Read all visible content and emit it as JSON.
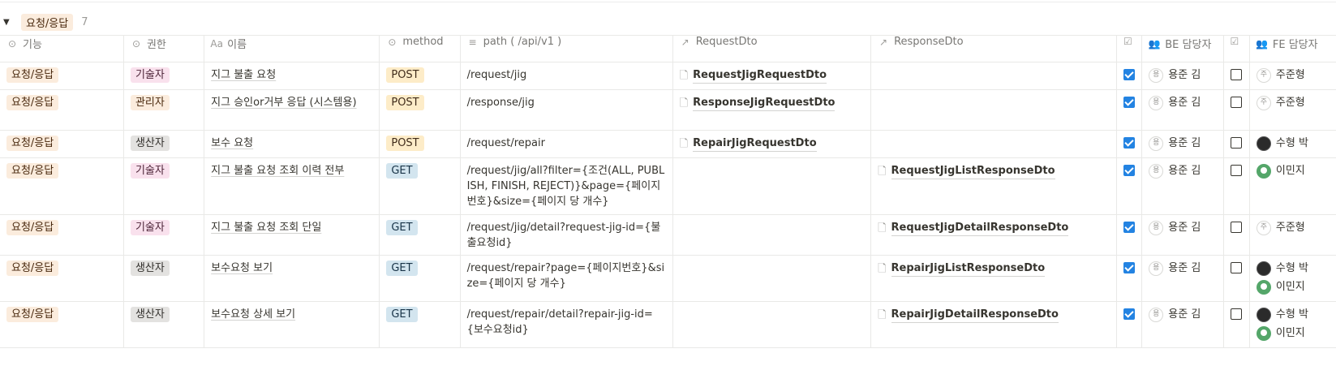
{
  "group": {
    "label": "요청/응답",
    "count": "7"
  },
  "columns": [
    {
      "label": "기능",
      "icon": "select-icon"
    },
    {
      "label": "권한",
      "icon": "select-icon"
    },
    {
      "label": "이름",
      "icon": "title-icon"
    },
    {
      "label": "method",
      "icon": "select-icon"
    },
    {
      "label": "path ( /api/v1 )",
      "icon": "text-icon"
    },
    {
      "label": "RequestDto",
      "icon": "relation-icon"
    },
    {
      "label": "ResponseDto",
      "icon": "relation-icon"
    },
    {
      "label": "",
      "icon": "checkbox-icon"
    },
    {
      "label": "BE 담당자",
      "icon": "person-icon"
    },
    {
      "label": "",
      "icon": "checkbox-icon"
    },
    {
      "label": "FE 담당자",
      "icon": "person-icon"
    }
  ],
  "rows": [
    {
      "feature": "요청/응답",
      "role": "기술자",
      "name": "지그 불출 요청",
      "method": "POST",
      "path": "/request/jig",
      "request_dto": "RequestJigRequestDto",
      "response_dto": "",
      "be_done": true,
      "be": "용준 김",
      "fe_done": false,
      "fe": [
        {
          "name": "주준형",
          "avatar": "주"
        }
      ]
    },
    {
      "feature": "요청/응답",
      "role": "관리자",
      "name": "지그 승인or거부 응답 (시스템용)",
      "method": "POST",
      "path": "/response/jig",
      "request_dto": "ResponseJigRequestDto",
      "response_dto": "",
      "be_done": true,
      "be": "용준 김",
      "fe_done": false,
      "fe": [
        {
          "name": "주준형",
          "avatar": "주"
        }
      ]
    },
    {
      "feature": "요청/응답",
      "role": "생산자",
      "name": "보수 요청",
      "method": "POST",
      "path": "/request/repair",
      "request_dto": "RepairJigRequestDto",
      "response_dto": "",
      "be_done": true,
      "be": "용준 김",
      "fe_done": false,
      "fe": [
        {
          "name": "수형 박",
          "avatar": ""
        }
      ]
    },
    {
      "feature": "요청/응답",
      "role": "기술자",
      "name": "지그 불출 요청 조회 이력 전부",
      "method": "GET",
      "path": "/request/jig/all?filter={조건(ALL, PUBLISH, FINISH, REJECT)}&page={페이지번호}&size={페이지 당 개수}",
      "request_dto": "",
      "response_dto": "RequestJigListResponseDto",
      "be_done": true,
      "be": "용준 김",
      "fe_done": false,
      "fe": [
        {
          "name": "이민지",
          "avatar": ""
        }
      ]
    },
    {
      "feature": "요청/응답",
      "role": "기술자",
      "name": "지그 불출 요청 조회 단일",
      "method": "GET",
      "path": "/request/jig/detail?request-jig-id={불출요청id}",
      "request_dto": "",
      "response_dto": "RequestJigDetailResponseDto",
      "be_done": true,
      "be": "용준 김",
      "fe_done": false,
      "fe": [
        {
          "name": "주준형",
          "avatar": "주"
        }
      ]
    },
    {
      "feature": "요청/응답",
      "role": "생산자",
      "name": "보수요청 보기",
      "method": "GET",
      "path": "/request/repair?page={페이지번호}&size={페이지 당 개수}",
      "request_dto": "",
      "response_dto": "RepairJigListResponseDto",
      "be_done": true,
      "be": "용준 김",
      "fe_done": false,
      "fe": [
        {
          "name": "수형 박",
          "avatar": ""
        },
        {
          "name": "이민지",
          "avatar": ""
        }
      ]
    },
    {
      "feature": "요청/응답",
      "role": "생산자",
      "name": "보수요청 상세 보기",
      "method": "GET",
      "path": "/request/repair/detail?repair-jig-id={보수요청id}",
      "request_dto": "",
      "response_dto": "RepairJigDetailResponseDto",
      "be_done": true,
      "be": "용준 김",
      "fe_done": false,
      "fe": [
        {
          "name": "수형 박",
          "avatar": ""
        },
        {
          "name": "이민지",
          "avatar": ""
        }
      ]
    }
  ],
  "colors": {
    "checked": "#2383e2",
    "post": "#fdecc8",
    "get": "#d3e5ef",
    "tech": "#f9e1ed",
    "prod": "#e3e2e0",
    "feature": "#fbecdd"
  }
}
